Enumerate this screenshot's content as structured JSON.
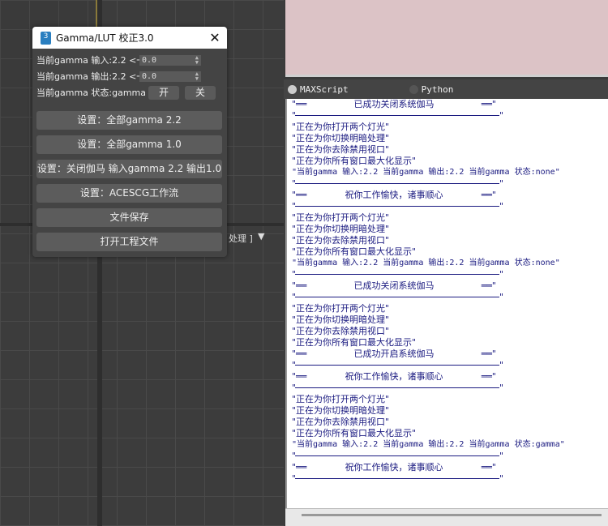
{
  "viewport": {
    "label": "处理 ]",
    "filter_icon": "filter-icon"
  },
  "dialog": {
    "title": "Gamma/LUT 校正3.0",
    "icon_text": "3",
    "input_label": "当前gamma 输入:2.2  <一",
    "input_value": "0.0",
    "output_label": "当前gamma 输出:2.2  <一",
    "output_value": "0.0",
    "state_label": "当前gamma 状态:gamma",
    "on_label": "开",
    "off_label": "关",
    "buttons": [
      "设置：全部gamma 2.2",
      "设置：全部gamma 1.0",
      "设置：关闭伽马 输入gamma 2.2 输出1.0",
      "设置：ACESCG工作流",
      "文件保存",
      "打开工程文件"
    ]
  },
  "listener": {
    "tabs": [
      "MAXScript",
      "Python"
    ],
    "selected_tab": "MAXScript",
    "rows": [
      {
        "t": "banner",
        "text": "已成功关闭系统伽马"
      },
      {
        "t": "sep"
      },
      {
        "t": "text",
        "text": "\"正在为你打开两个灯光\""
      },
      {
        "t": "text",
        "text": "\"正在为你切换明暗处理\""
      },
      {
        "t": "text",
        "text": "\"正在为你去除禁用视口\""
      },
      {
        "t": "text",
        "text": "\"正在为你所有窗口最大化显示\""
      },
      {
        "t": "mono",
        "text": "\"当前gamma 输入:2.2  当前gamma 输出:2.2  当前gamma 状态:none\""
      },
      {
        "t": "sep"
      },
      {
        "t": "banner",
        "text": "祝你工作愉快，诸事顺心"
      },
      {
        "t": "sep"
      },
      {
        "t": "text",
        "text": "\"正在为你打开两个灯光\""
      },
      {
        "t": "text",
        "text": "\"正在为你切换明暗处理\""
      },
      {
        "t": "text",
        "text": "\"正在为你去除禁用视口\""
      },
      {
        "t": "text",
        "text": "\"正在为你所有窗口最大化显示\""
      },
      {
        "t": "mono",
        "text": "\"当前gamma 输入:2.2  当前gamma 输出:2.2  当前gamma 状态:none\""
      },
      {
        "t": "sep"
      },
      {
        "t": "banner",
        "text": "已成功关闭系统伽马"
      },
      {
        "t": "sep"
      },
      {
        "t": "text",
        "text": "\"正在为你打开两个灯光\""
      },
      {
        "t": "text",
        "text": "\"正在为你切换明暗处理\""
      },
      {
        "t": "text",
        "text": "\"正在为你去除禁用视口\""
      },
      {
        "t": "text",
        "text": "\"正在为你所有窗口最大化显示\""
      },
      {
        "t": "banner",
        "text": "已成功开启系统伽马"
      },
      {
        "t": "sep"
      },
      {
        "t": "banner",
        "text": "祝你工作愉快，诸事顺心"
      },
      {
        "t": "sep"
      },
      {
        "t": "text",
        "text": "\"正在为你打开两个灯光\""
      },
      {
        "t": "text",
        "text": "\"正在为你切换明暗处理\""
      },
      {
        "t": "text",
        "text": "\"正在为你去除禁用视口\""
      },
      {
        "t": "text",
        "text": "\"正在为你所有窗口最大化显示\""
      },
      {
        "t": "mono",
        "text": "\"当前gamma 输入:2.2  当前gamma 输出:2.2  当前gamma 状态:gamma\""
      },
      {
        "t": "sep"
      },
      {
        "t": "banner",
        "text": "祝你工作愉快，诸事顺心"
      },
      {
        "t": "sep"
      }
    ]
  }
}
